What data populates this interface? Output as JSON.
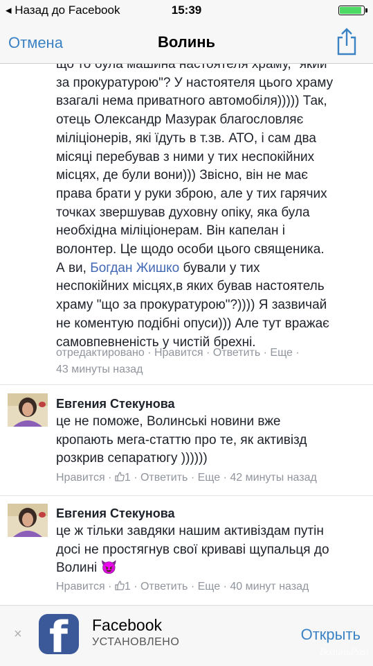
{
  "status_bar": {
    "back_label": "◂ Назад до Facebook",
    "time": "15:39",
    "battery_level": 0.85
  },
  "nav_bar": {
    "cancel_label": "Отмена",
    "title": "Волинь",
    "share_icon": "share-icon"
  },
  "comment_1": {
    "text_before_mention": "що то була машина настоятеля храму, \"який\nза прокуратурою\"? У настоятеля цього храму\nвзагалі нема приватного автомобіля))))) Так,\nотець Олександр Мазурак благословляє\nміліціонерів, які їдуть в т.зв. АТО, і сам два\nмісяці перебував з ними у тих неспокійних\nмісцях, де були вони))) Звісно, він не має\nправа брати у руки зброю, але у тих гарячих\nточках звершував духовну опіку, яка була\nнеобхідна міліціонерам. Він капелан і\nволонтер. Це щодо особи цього священика.\nА ви, ",
    "mention": "Богдан Жишко",
    "text_after_mention": " бували у тих\nнеспокійних місцях,в яких бував настоятель\nхраму \"що за прокуратурою\"?)))) Я зазвичай\nне коментую подібні опуси))) Але тут вражає\nсамовпевненість у чистій брехні.",
    "meta_line1": "отредактировано · Нравится · Ответить · Еще ·",
    "meta_line2": "43 минуты назад"
  },
  "comment_2": {
    "author": "Евгения Стекунова",
    "text": "це не поможе, Волинські новини вже\nкропають мега-статтю про те, як активізд\nрозкрив сепаратюгу ))))))",
    "like_label": "Нравится",
    "like_count": "1",
    "reply_label": "Ответить",
    "more_label": "Еще",
    "time": "42 минуты назад"
  },
  "comment_3": {
    "author": "Евгения Стекунова",
    "text": "це ж тільки завдяки нашим активіздам путін\nдосі не простягнув свої криваві щупальця до\nВолині",
    "emoji": "😈",
    "like_label": "Нравится",
    "like_count": "1",
    "reply_label": "Ответить",
    "more_label": "Еще",
    "time": "40 минут назад"
  },
  "banner": {
    "close_label": "×",
    "app_name": "Facebook",
    "app_status": "УСТАНОВЛЕНО",
    "open_label": "Открыть",
    "icon": "facebook-app-icon",
    "watermark": "ВолиньPost"
  },
  "colors": {
    "link_blue": "#3b82c4",
    "mention_blue": "#4267b2",
    "facebook_blue": "#3b5998",
    "meta_gray": "#90949c"
  }
}
